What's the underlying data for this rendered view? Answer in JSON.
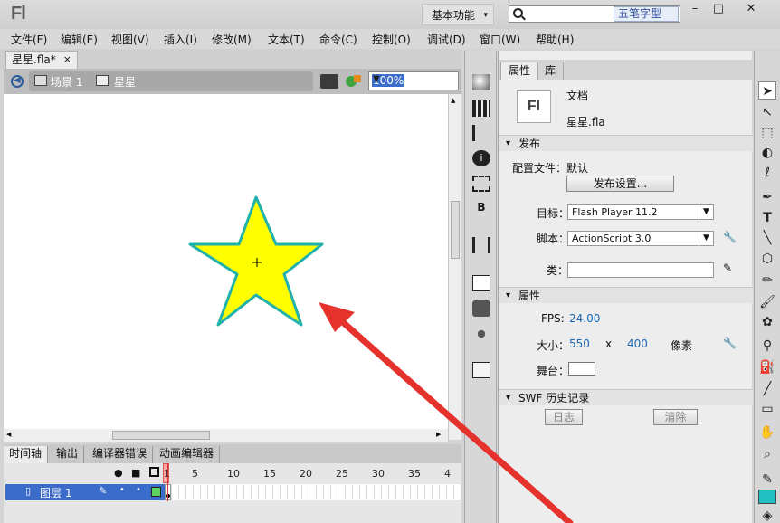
{
  "app": {
    "logo": "Fl",
    "workspace": "基本功能",
    "search_tag": "五笔字型"
  },
  "window_controls": {
    "minimize": "–",
    "maximize": "□",
    "close": "✕"
  },
  "menu": [
    "文件(F)",
    "编辑(E)",
    "视图(V)",
    "插入(I)",
    "修改(M)",
    "文本(T)",
    "命令(C)",
    "控制(O)",
    "调试(D)",
    "窗口(W)",
    "帮助(H)"
  ],
  "doc_tab": {
    "label": "星星.fla*",
    "close": "×"
  },
  "editbar": {
    "scene": "场景 1",
    "symbol": "星星",
    "zoom": "100%"
  },
  "timeline": {
    "tabs": [
      "时间轴",
      "输出",
      "编译器错误",
      "动画编辑器"
    ],
    "frames": [
      "1",
      "5",
      "10",
      "15",
      "20",
      "25",
      "30",
      "35",
      "4"
    ],
    "layer": "图层 1"
  },
  "properties": {
    "tabs": [
      "属性",
      "库"
    ],
    "doc_type": "文档",
    "doc_name": "星星.fla",
    "logo": "Fl",
    "publish": {
      "section": "发布",
      "profile_label": "配置文件：",
      "profile_value": "默认",
      "settings_button": "发布设置...",
      "target_label": "目标：",
      "target_value": "Flash Player 11.2",
      "script_label": "脚本：",
      "script_value": "ActionScript 3.0",
      "class_label": "类："
    },
    "attributes": {
      "section": "属性",
      "fps_label": "FPS:",
      "fps_value": "24.00",
      "size_label": "大小：",
      "width": "550",
      "x": "x",
      "height": "400",
      "unit": "像素",
      "stage_label": "舞台："
    },
    "swf": {
      "section": "SWF 历史记录",
      "log_button": "日志",
      "clear_button": "清除"
    }
  },
  "colors": {
    "star_fill": "#ffff00",
    "star_stroke": "#20b2aa",
    "arrow": "#e5322d",
    "selection": "#3b6cc9",
    "fill_swatch": "#20c0c0"
  },
  "tools_icons": [
    "selection-icon",
    "subselection-icon",
    "free-transform-icon",
    "3d-rotation-icon",
    "lasso-icon",
    "pen-icon",
    "text-icon",
    "line-icon",
    "rectangle-icon",
    "pencil-icon",
    "brush-icon",
    "deco-icon",
    "bone-icon",
    "paint-bucket-icon",
    "eyedropper-icon",
    "eraser-icon",
    "hand-icon",
    "zoom-icon",
    "stroke-color-icon",
    "fill-color-icon"
  ]
}
